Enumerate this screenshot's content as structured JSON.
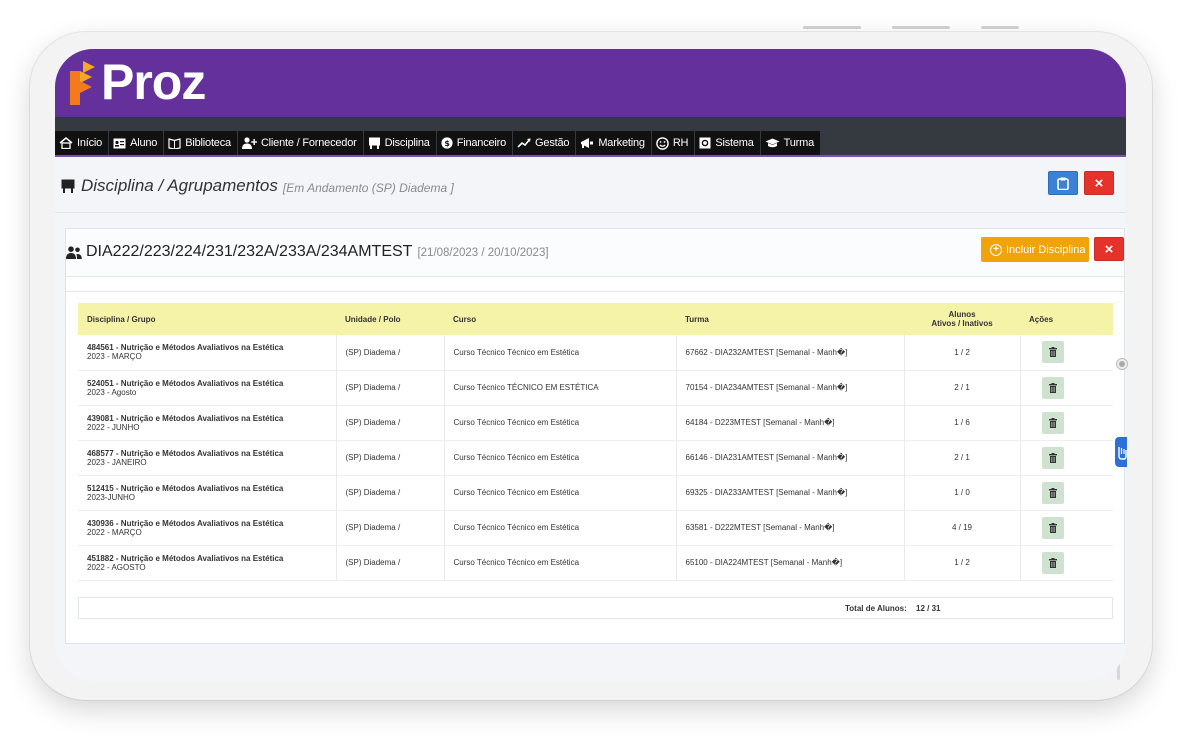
{
  "brand": {
    "name": "Proz"
  },
  "nav": {
    "items": [
      {
        "label": "Início",
        "icon": "home-icon"
      },
      {
        "label": "Aluno",
        "icon": "id-card-icon"
      },
      {
        "label": "Biblioteca",
        "icon": "book-icon"
      },
      {
        "label": "Cliente / Fornecedor",
        "icon": "user-plus-icon"
      },
      {
        "label": "Disciplina",
        "icon": "chalkboard-icon"
      },
      {
        "label": "Financeiro",
        "icon": "dollar-circle-icon"
      },
      {
        "label": "Gestão",
        "icon": "trend-icon"
      },
      {
        "label": "Marketing",
        "icon": "megaphone-icon"
      },
      {
        "label": "RH",
        "icon": "smile-icon"
      },
      {
        "label": "Sistema",
        "icon": "gear-box-icon"
      },
      {
        "label": "Turma",
        "icon": "graduation-cap-icon"
      }
    ]
  },
  "page": {
    "title": "Disciplina / Agrupamentos",
    "subtitle": "[Em Andamento (SP) Diadema ]",
    "close_label": "×"
  },
  "group": {
    "title": "DIA222/223/224/231/232A/233A/234AMTEST",
    "period": "[21/08/2023 / 20/10/2023]",
    "add_label": "Incluir Disciplina",
    "close_label": "×"
  },
  "table": {
    "headers": {
      "disciplina": "Disciplina / Grupo",
      "unidade": "Unidade / Polo",
      "curso": "Curso",
      "turma": "Turma",
      "alunos_line1": "Alunos",
      "alunos_line2": "Ativos / Inativos",
      "acoes": "Ações"
    },
    "rows": [
      {
        "code": "484561 - Nutrição e Métodos Avaliativos na Estética",
        "group": "2023 - MARÇO",
        "unit": "(SP) Diadema /",
        "course": "Curso Técnico Técnico em Estética",
        "class": "67662 - DIA232AMTEST [Semanal - Manh�]",
        "students": "1 / 2"
      },
      {
        "code": "524051 - Nutrição e Métodos Avaliativos na Estética",
        "group": "2023 - Agosto",
        "unit": "(SP) Diadema /",
        "course": "Curso Técnico TÉCNICO EM ESTÉTICA",
        "class": "70154 - DIA234AMTEST [Semanal - Manh�]",
        "students": "2 / 1"
      },
      {
        "code": "439081 - Nutrição e Métodos Avaliativos na Estética",
        "group": "2022 - JUNHO",
        "unit": "(SP) Diadema /",
        "course": "Curso Técnico Técnico em Estética",
        "class": "64184 - D223MTEST [Semanal - Manh�]",
        "students": "1 / 6"
      },
      {
        "code": "468577 - Nutrição e Métodos Avaliativos na Estética",
        "group": "2023 - JANEIRO",
        "unit": "(SP) Diadema /",
        "course": "Curso Técnico Técnico em Estética",
        "class": "66146 - DIA231AMTEST [Semanal - Manh�]",
        "students": "2 / 1"
      },
      {
        "code": "512415 - Nutrição e Métodos Avaliativos na Estética",
        "group": "2023-JUNHO",
        "unit": "(SP) Diadema /",
        "course": "Curso Técnico Técnico em Estética",
        "class": "69325 - DIA233AMTEST [Semanal - Manh�]",
        "students": "1 / 0"
      },
      {
        "code": "430936 - Nutrição e Métodos Avaliativos na Estética",
        "group": "2022 - MARÇO",
        "unit": "(SP) Diadema /",
        "course": "Curso Técnico Técnico em Estética",
        "class": "63581 - D222MTEST [Semanal - Manh�]",
        "students": "4 / 19"
      },
      {
        "code": "451882 - Nutrição e Métodos Avaliativos na Estética",
        "group": "2022 - AGOSTO",
        "unit": "(SP) Diadema /",
        "course": "Curso Técnico Técnico em Estética",
        "class": "65100 - DIA224MTEST [Semanal - Manh�]",
        "students": "1 / 2"
      }
    ]
  },
  "totals": {
    "label": "Total de Alunos:",
    "value": "12 / 31"
  },
  "colors": {
    "brand": "#64319c",
    "nav": "#343a40",
    "header_row": "#f5f3a8",
    "orange": "#f0a30a",
    "red": "#e5322b",
    "blue": "#3b82d6"
  }
}
